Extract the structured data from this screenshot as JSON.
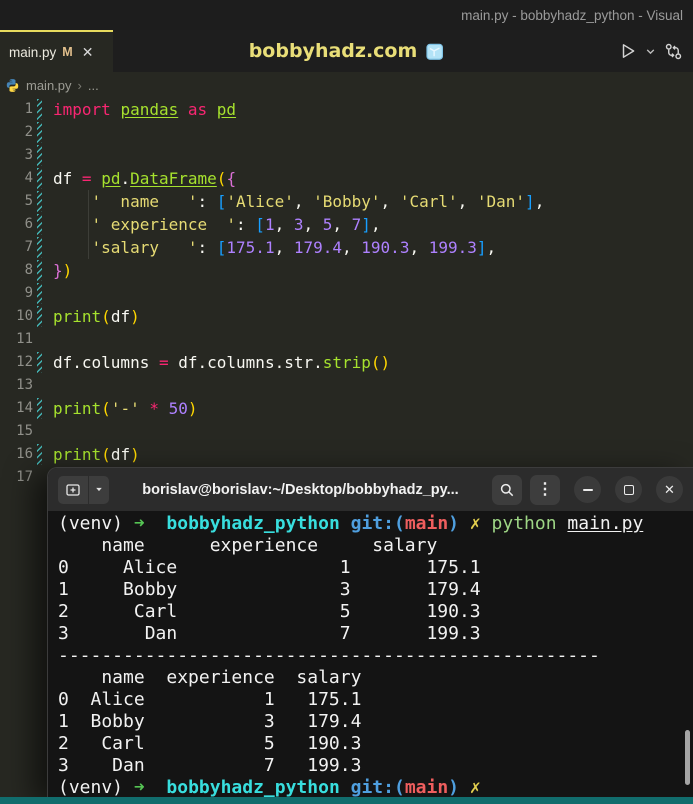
{
  "window": {
    "title_right": "main.py - bobbyhadz_python - Visual"
  },
  "tab_bar": {
    "active_tab": {
      "label": "main.py",
      "modified_badge": "M",
      "close_glyph": "✕"
    },
    "command_center": {
      "title": "bobbyhadz.com",
      "icon": "ice-cube"
    },
    "actions": [
      "run-python-file",
      "run-dropdown",
      "open-changes"
    ]
  },
  "breadcrumb": {
    "file": "main.py",
    "separator": "›",
    "ellipsis": "..."
  },
  "editor": {
    "language": "python",
    "lines": [
      {
        "n": 1,
        "git": true,
        "guide": false,
        "segs": [
          {
            "t": "import",
            "c": "k"
          },
          {
            "t": " ",
            "c": "w"
          },
          {
            "t": "pandas",
            "c": "g",
            "u": true
          },
          {
            "t": " ",
            "c": "w"
          },
          {
            "t": "as",
            "c": "k"
          },
          {
            "t": " ",
            "c": "w"
          },
          {
            "t": "pd",
            "c": "g",
            "u": true
          }
        ]
      },
      {
        "n": 2,
        "git": true,
        "guide": false,
        "segs": []
      },
      {
        "n": 3,
        "git": true,
        "guide": false,
        "segs": []
      },
      {
        "n": 4,
        "git": true,
        "guide": false,
        "segs": [
          {
            "t": "df ",
            "c": "w"
          },
          {
            "t": "=",
            "c": "k"
          },
          {
            "t": " ",
            "c": "w"
          },
          {
            "t": "pd",
            "c": "g",
            "u": true
          },
          {
            "t": ".",
            "c": "w"
          },
          {
            "t": "DataFrame",
            "c": "g",
            "u": true
          },
          {
            "t": "(",
            "c": "b1"
          },
          {
            "t": "{",
            "c": "b2"
          }
        ]
      },
      {
        "n": 5,
        "git": true,
        "guide": true,
        "segs": [
          {
            "t": "    ",
            "c": "w"
          },
          {
            "t": "'  name   '",
            "c": "y"
          },
          {
            "t": ": ",
            "c": "w"
          },
          {
            "t": "[",
            "c": "b3"
          },
          {
            "t": "'Alice'",
            "c": "y"
          },
          {
            "t": ", ",
            "c": "w"
          },
          {
            "t": "'Bobby'",
            "c": "y"
          },
          {
            "t": ", ",
            "c": "w"
          },
          {
            "t": "'Carl'",
            "c": "y"
          },
          {
            "t": ", ",
            "c": "w"
          },
          {
            "t": "'Dan'",
            "c": "y"
          },
          {
            "t": "]",
            "c": "b3"
          },
          {
            "t": ",",
            "c": "w"
          }
        ]
      },
      {
        "n": 6,
        "git": true,
        "guide": true,
        "segs": [
          {
            "t": "    ",
            "c": "w"
          },
          {
            "t": "' experience  '",
            "c": "y"
          },
          {
            "t": ": ",
            "c": "w"
          },
          {
            "t": "[",
            "c": "b3"
          },
          {
            "t": "1",
            "c": "n"
          },
          {
            "t": ", ",
            "c": "w"
          },
          {
            "t": "3",
            "c": "n"
          },
          {
            "t": ", ",
            "c": "w"
          },
          {
            "t": "5",
            "c": "n"
          },
          {
            "t": ", ",
            "c": "w"
          },
          {
            "t": "7",
            "c": "n"
          },
          {
            "t": "]",
            "c": "b3"
          },
          {
            "t": ",",
            "c": "w"
          }
        ]
      },
      {
        "n": 7,
        "git": true,
        "guide": true,
        "segs": [
          {
            "t": "    ",
            "c": "w"
          },
          {
            "t": "'salary   '",
            "c": "y"
          },
          {
            "t": ": ",
            "c": "w"
          },
          {
            "t": "[",
            "c": "b3"
          },
          {
            "t": "175.1",
            "c": "n"
          },
          {
            "t": ", ",
            "c": "w"
          },
          {
            "t": "179.4",
            "c": "n"
          },
          {
            "t": ", ",
            "c": "w"
          },
          {
            "t": "190.3",
            "c": "n"
          },
          {
            "t": ", ",
            "c": "w"
          },
          {
            "t": "199.3",
            "c": "n"
          },
          {
            "t": "]",
            "c": "b3"
          },
          {
            "t": ",",
            "c": "w"
          }
        ]
      },
      {
        "n": 8,
        "git": true,
        "guide": false,
        "segs": [
          {
            "t": "}",
            "c": "b2"
          },
          {
            "t": ")",
            "c": "b1"
          }
        ]
      },
      {
        "n": 9,
        "git": true,
        "guide": false,
        "segs": []
      },
      {
        "n": 10,
        "git": true,
        "guide": false,
        "segs": [
          {
            "t": "print",
            "c": "g"
          },
          {
            "t": "(",
            "c": "b1"
          },
          {
            "t": "df",
            "c": "w"
          },
          {
            "t": ")",
            "c": "b1"
          }
        ]
      },
      {
        "n": 11,
        "git": false,
        "guide": false,
        "segs": []
      },
      {
        "n": 12,
        "git": true,
        "guide": false,
        "segs": [
          {
            "t": "df.columns ",
            "c": "w"
          },
          {
            "t": "=",
            "c": "k"
          },
          {
            "t": " df.columns.str.",
            "c": "w"
          },
          {
            "t": "strip",
            "c": "g"
          },
          {
            "t": "(",
            "c": "b1"
          },
          {
            "t": ")",
            "c": "b1"
          }
        ]
      },
      {
        "n": 13,
        "git": false,
        "guide": false,
        "segs": []
      },
      {
        "n": 14,
        "git": true,
        "guide": false,
        "segs": [
          {
            "t": "print",
            "c": "g"
          },
          {
            "t": "(",
            "c": "b1"
          },
          {
            "t": "'-'",
            "c": "y"
          },
          {
            "t": " ",
            "c": "w"
          },
          {
            "t": "*",
            "c": "k"
          },
          {
            "t": " ",
            "c": "w"
          },
          {
            "t": "50",
            "c": "n"
          },
          {
            "t": ")",
            "c": "b1"
          }
        ]
      },
      {
        "n": 15,
        "git": false,
        "guide": false,
        "segs": []
      },
      {
        "n": 16,
        "git": true,
        "guide": false,
        "segs": [
          {
            "t": "print",
            "c": "g"
          },
          {
            "t": "(",
            "c": "b1"
          },
          {
            "t": "df",
            "c": "w"
          },
          {
            "t": ")",
            "c": "b1"
          }
        ]
      },
      {
        "n": 17,
        "git": false,
        "guide": false,
        "segs": []
      }
    ]
  },
  "terminal": {
    "titlebar": {
      "title": "borislav@borislav:~/Desktop/bobbyhadz_py..."
    },
    "lines": [
      [
        {
          "t": "(venv) ",
          "c": "tw"
        },
        {
          "t": "➜",
          "c": "tg",
          "b": true
        },
        {
          "t": "  ",
          "c": "tw"
        },
        {
          "t": "bobbyhadz_python",
          "c": "tc",
          "b": true
        },
        {
          "t": " ",
          "c": "tw"
        },
        {
          "t": "git:(",
          "c": "tb",
          "b": true
        },
        {
          "t": "main",
          "c": "tr",
          "b": true
        },
        {
          "t": ")",
          "c": "tb",
          "b": true
        },
        {
          "t": " ",
          "c": "tw"
        },
        {
          "t": "✗",
          "c": "ty",
          "b": true
        },
        {
          "t": " ",
          "c": "tw"
        },
        {
          "t": "python",
          "c": "tgr"
        },
        {
          "t": " ",
          "c": "tw"
        },
        {
          "t": "main.py",
          "c": "tw",
          "u": true
        }
      ],
      [
        {
          "t": "    name      experience     salary",
          "c": "tw"
        }
      ],
      [
        {
          "t": "0     Alice               1       175.1",
          "c": "tw"
        }
      ],
      [
        {
          "t": "1     Bobby               3       179.4",
          "c": "tw"
        }
      ],
      [
        {
          "t": "2      Carl               5       190.3",
          "c": "tw"
        }
      ],
      [
        {
          "t": "3       Dan               7       199.3",
          "c": "tw"
        }
      ],
      [
        {
          "t": "--------------------------------------------------",
          "c": "tw"
        }
      ],
      [
        {
          "t": "    name  experience  salary",
          "c": "tw"
        }
      ],
      [
        {
          "t": "0  Alice           1   175.1",
          "c": "tw"
        }
      ],
      [
        {
          "t": "1  Bobby           3   179.4",
          "c": "tw"
        }
      ],
      [
        {
          "t": "2   Carl           5   190.3",
          "c": "tw"
        }
      ],
      [
        {
          "t": "3    Dan           7   199.3",
          "c": "tw"
        }
      ],
      [
        {
          "t": "(venv) ",
          "c": "tw"
        },
        {
          "t": "➜",
          "c": "tg",
          "b": true
        },
        {
          "t": "  ",
          "c": "tw"
        },
        {
          "t": "bobbyhadz_python",
          "c": "tc",
          "b": true
        },
        {
          "t": " ",
          "c": "tw"
        },
        {
          "t": "git:(",
          "c": "tb",
          "b": true
        },
        {
          "t": "main",
          "c": "tr",
          "b": true
        },
        {
          "t": ")",
          "c": "tb",
          "b": true
        },
        {
          "t": " ",
          "c": "tw"
        },
        {
          "t": "✗",
          "c": "ty",
          "b": true
        }
      ]
    ]
  },
  "colors": {
    "accent_yellow": "#e6db74",
    "keyword_pink": "#f92672",
    "function_green": "#a6e22e",
    "number_purple": "#ae81ff",
    "editor_fg": "#f8f8f2",
    "editor_bg": "#272822",
    "bracket_gold": "#ffd700",
    "bracket_orchid": "#da70d6",
    "bracket_blue": "#179fff",
    "git_marker_teal": "#43b3b3",
    "tab_modified": "#e2c08d",
    "terminal_bg": "#141414",
    "terminal_header_bg": "#2c2c2c",
    "prompt_green": "#55c454",
    "prompt_cyan": "#38dede",
    "prompt_blue": "#4f9fdf",
    "prompt_red": "#ef5e5e",
    "prompt_yellow": "#e3cf4e",
    "command_green": "#9ed685",
    "status_teal": "#116d6d"
  }
}
